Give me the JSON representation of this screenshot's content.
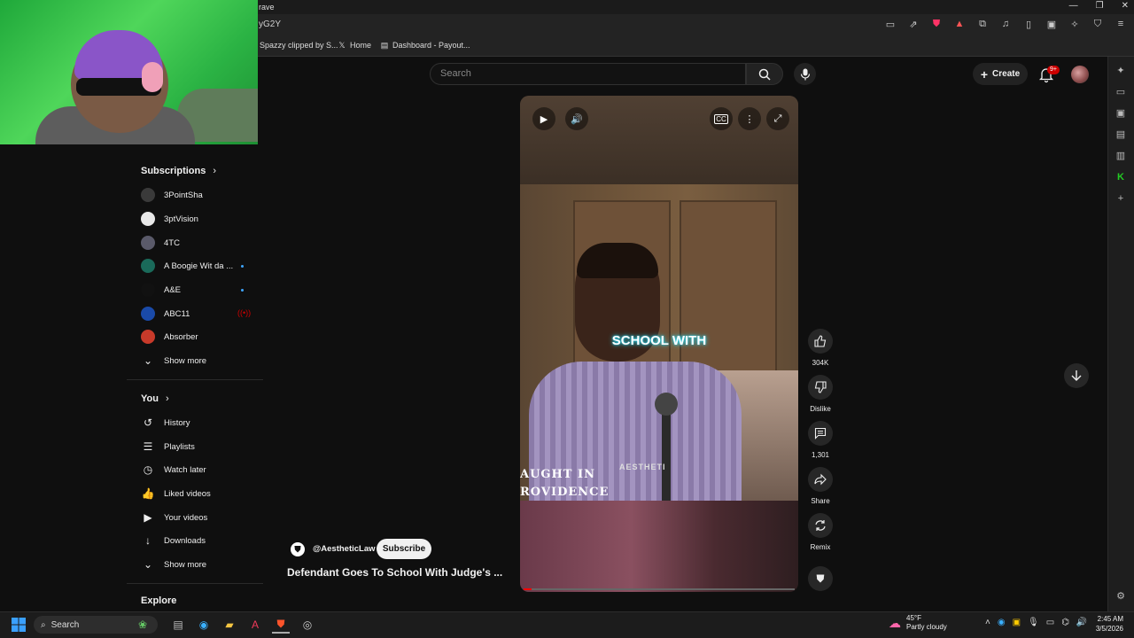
{
  "browser": {
    "tab_title": "rave",
    "url_fragment": "yG2Y",
    "bookmarks": [
      {
        "label": "Spazzy clipped by S...",
        "icon": "none"
      },
      {
        "label": "Home",
        "icon": "x-icon"
      },
      {
        "label": "Dashboard - Payout...",
        "icon": "page-icon"
      }
    ]
  },
  "header": {
    "search_placeholder": "Search",
    "create_label": "Create",
    "notification_badge": "9+"
  },
  "sidebar": {
    "subscriptions_label": "Subscriptions",
    "channels": [
      {
        "name": "3PointSha",
        "color": "#3a3a3a",
        "live": false,
        "new": false
      },
      {
        "name": "3ptVision",
        "color": "#e8e8e8",
        "live": false,
        "new": false
      },
      {
        "name": "4TC",
        "color": "#5a5a6a",
        "live": false,
        "new": false
      },
      {
        "name": "A Boogie Wit da ...",
        "color": "#1a6a5a",
        "live": false,
        "new": true
      },
      {
        "name": "A&E",
        "color": "#111111",
        "live": false,
        "new": true
      },
      {
        "name": "ABC11",
        "color": "#1a4aa8",
        "live": true,
        "new": false
      },
      {
        "name": "Absorber",
        "color": "#c83a2a",
        "live": false,
        "new": false
      }
    ],
    "show_more_1": "Show more",
    "you_label": "You",
    "you_items": [
      {
        "label": "History",
        "icon": "history-icon",
        "glyph": "↺"
      },
      {
        "label": "Playlists",
        "icon": "playlists-icon",
        "glyph": "☰"
      },
      {
        "label": "Watch later",
        "icon": "clock-icon",
        "glyph": "◷"
      },
      {
        "label": "Liked videos",
        "icon": "thumbs-up-icon",
        "glyph": "👍"
      },
      {
        "label": "Your videos",
        "icon": "video-icon",
        "glyph": "▶"
      },
      {
        "label": "Downloads",
        "icon": "download-icon",
        "glyph": "↓"
      }
    ],
    "show_more_2": "Show more",
    "explore_label": "Explore"
  },
  "video": {
    "caption": "SCHOOL WITH",
    "lower_text_1": "AUGHT IN",
    "lower_text_2": "ROVIDENCE",
    "watermark": "AESTHETI",
    "progress": 0.03
  },
  "actions": {
    "likes": "304K",
    "dislike_label": "Dislike",
    "comments": "1,301",
    "share_label": "Share",
    "remix_label": "Remix"
  },
  "channel": {
    "handle": "@AestheticLaw",
    "subscribe_label": "Subscribe"
  },
  "title": "Defendant Goes To School With Judge's ...",
  "taskbar": {
    "search_label": "Search",
    "weather_temp": "45°F",
    "weather_desc": "Partly cloudy",
    "time": "2:45 AM",
    "date": "3/5/2026"
  }
}
